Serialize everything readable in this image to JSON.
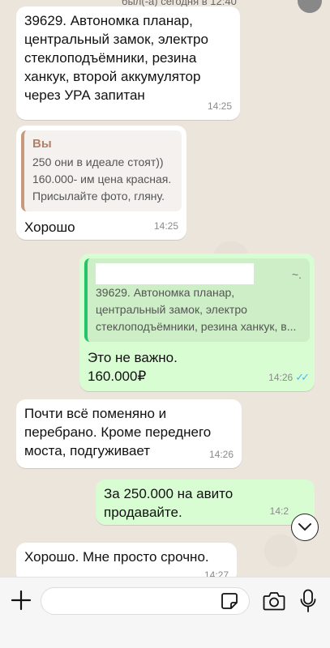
{
  "header": {
    "fragment": "был(-а) сегодня в 12:40"
  },
  "messages": [
    {
      "text": "39629. Автономка планар,\nцентральный замок, электро\nстеклоподъёмники, резина\nханкук, второй аккумулятор\nчерез УРА запитан",
      "time": "14:25"
    },
    {
      "quote_sender": "Вы",
      "quote_text": "250 они в идеале стоят))\n160.000- им цена красная.\nПрисылайте фото, гляну.",
      "text": "Хорошо",
      "time": "14:25"
    },
    {
      "quote_text": "39629. Автономка планар,\nцентральный замок, электро\nстеклоподъёмники, резина ханкук, в...",
      "quote_suffix": "~.",
      "text": "Это не важно.\n160.000₽",
      "time": "14:26"
    },
    {
      "text": "Почти всё поменяно и\nперебрано. Кроме переднего\nмоста, подгуживает",
      "time": "14:26"
    },
    {
      "text": "За 250.000 на авито\nпродавайте.",
      "time": "14:2"
    },
    {
      "text": "Хорошо. Мне просто срочно.",
      "time": "14:27"
    }
  ],
  "input": {
    "placeholder": ""
  },
  "icons": {
    "plus": "plus-icon",
    "sticker": "sticker-icon",
    "camera": "camera-icon",
    "mic": "microphone-icon",
    "scroll": "chevron-down-icon",
    "read": "double-check-icon"
  },
  "colors": {
    "incoming": "#ffffff",
    "outgoing": "#d9fdd3",
    "read_ticks": "#4fb6ec"
  }
}
